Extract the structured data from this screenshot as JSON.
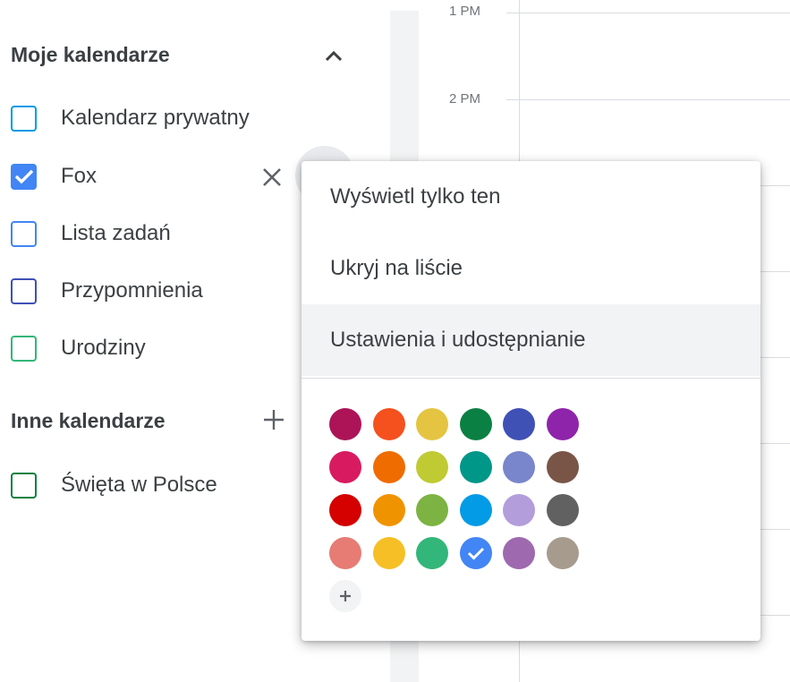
{
  "sidebar": {
    "my_calendars": {
      "title": "Moje kalendarze",
      "collapse_icon": "chevron-up-icon",
      "items": [
        {
          "label": "Kalendarz prywatny",
          "color": "#039be5",
          "checked": false
        },
        {
          "label": "Fox",
          "color": "#4285f4",
          "checked": true
        },
        {
          "label": "Lista zadań",
          "color": "#4285f4",
          "checked": false
        },
        {
          "label": "Przypomnienia",
          "color": "#3f51b5",
          "checked": false
        },
        {
          "label": "Urodziny",
          "color": "#33b679",
          "checked": false
        }
      ]
    },
    "other_calendars": {
      "title": "Inne kalendarze",
      "add_icon": "plus-icon",
      "items": [
        {
          "label": "Święta w Polsce",
          "color": "#0b8043",
          "checked": false
        }
      ]
    },
    "remove_icon": "close-icon"
  },
  "grid": {
    "times": [
      "1 PM",
      "2 PM"
    ]
  },
  "context_menu": {
    "items": [
      {
        "label": "Wyświetl tylko ten"
      },
      {
        "label": "Ukryj na liście"
      },
      {
        "label": "Ustawienia i udostępnianie",
        "highlighted": true
      }
    ],
    "colors": [
      [
        "#ad1457",
        "#f4511e",
        "#e4c441",
        "#0b8043",
        "#3f51b5",
        "#8e24aa"
      ],
      [
        "#d81b60",
        "#ef6c00",
        "#c0ca33",
        "#009688",
        "#7986cb",
        "#795548"
      ],
      [
        "#d50000",
        "#f09300",
        "#7cb342",
        "#039be5",
        "#b39ddb",
        "#616161"
      ],
      [
        "#e67c73",
        "#f6bf26",
        "#33b679",
        "#4285f4",
        "#9e69af",
        "#a79b8e"
      ]
    ],
    "selected_color": "#4285f4",
    "add_color_icon": "plus-icon"
  }
}
